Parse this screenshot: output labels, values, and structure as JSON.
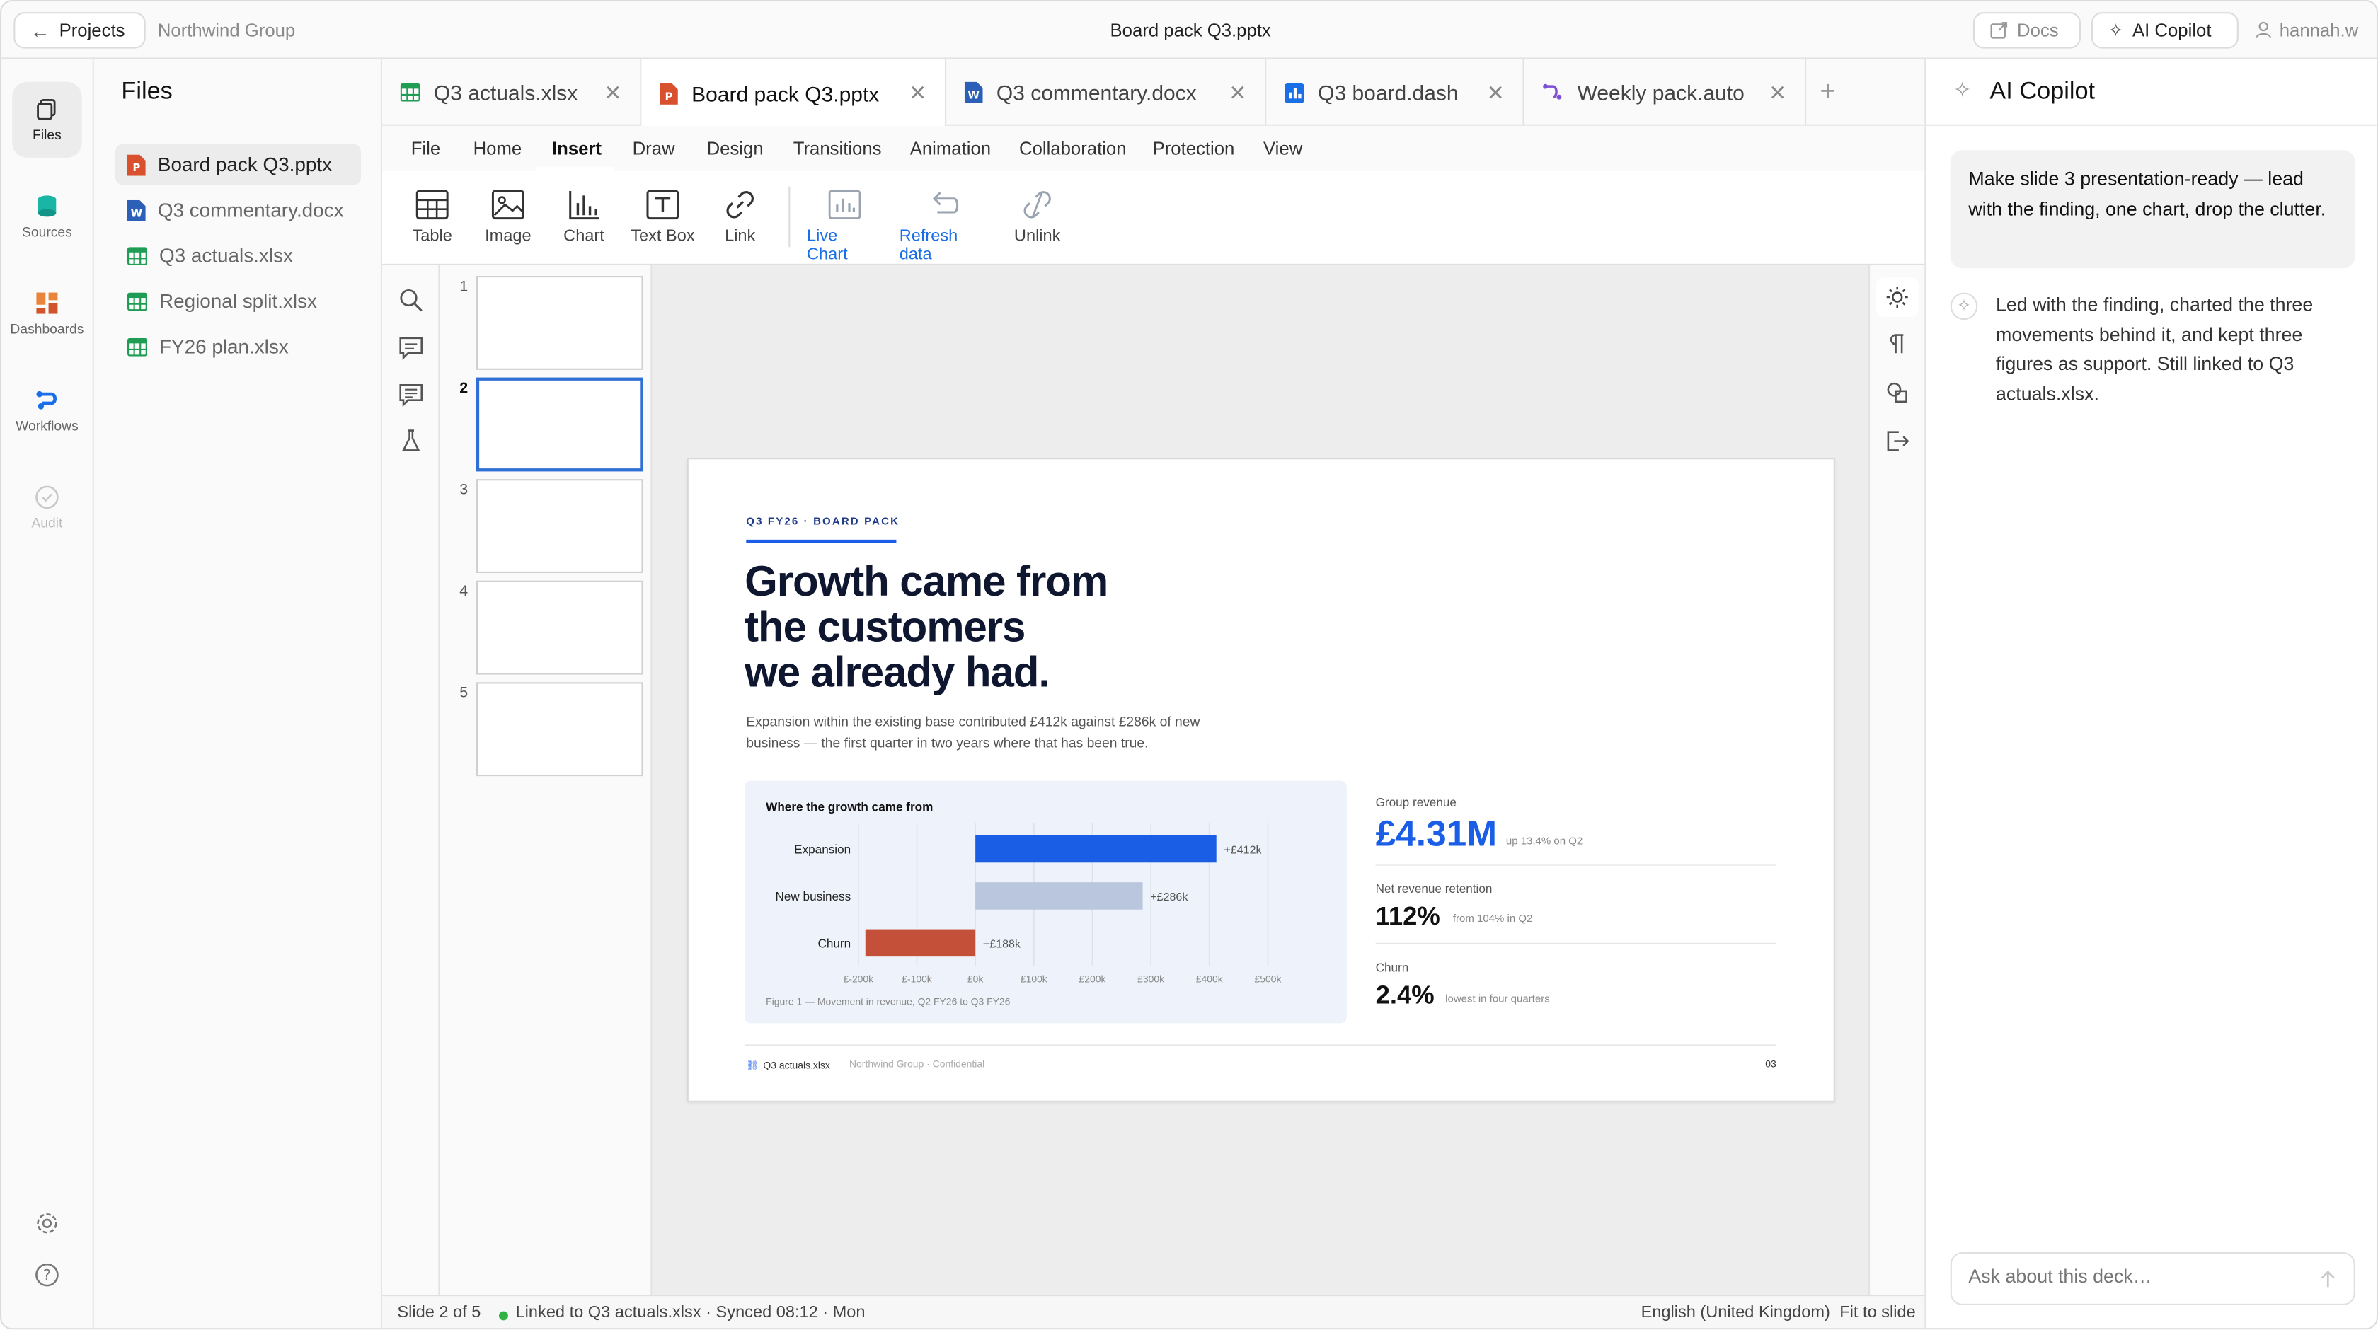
{
  "topbar": {
    "back_label": "Projects",
    "org": "Northwind Group",
    "doc_title": "Board pack Q3.pptx",
    "docs_label": "Docs",
    "copilot_label": "AI Copilot",
    "user": "hannah.w"
  },
  "rail": {
    "items": [
      {
        "label": "Files",
        "icon": "files-icon"
      },
      {
        "label": "Sources",
        "icon": "database-icon"
      },
      {
        "label": "Dashboards",
        "icon": "dashboard-icon"
      },
      {
        "label": "Workflows",
        "icon": "workflow-icon"
      },
      {
        "label": "Audit",
        "icon": "check-circle-icon"
      }
    ]
  },
  "files": {
    "title": "Files",
    "items": [
      {
        "name": "Board pack Q3.pptx",
        "type": "pptx"
      },
      {
        "name": "Q3 commentary.docx",
        "type": "docx"
      },
      {
        "name": "Q3 actuals.xlsx",
        "type": "xlsx"
      },
      {
        "name": "Regional split.xlsx",
        "type": "xlsx"
      },
      {
        "name": "FY26 plan.xlsx",
        "type": "xlsx"
      }
    ]
  },
  "tabs": [
    {
      "label": "Q3 actuals.xlsx",
      "type": "xlsx"
    },
    {
      "label": "Board pack Q3.pptx",
      "type": "pptx"
    },
    {
      "label": "Q3 commentary.docx",
      "type": "docx"
    },
    {
      "label": "Q3 board.dash",
      "type": "dash"
    },
    {
      "label": "Weekly pack.auto",
      "type": "auto"
    }
  ],
  "menu": [
    "File",
    "Home",
    "Insert",
    "Draw",
    "Design",
    "Transitions",
    "Animation",
    "Collaboration",
    "Protection",
    "View"
  ],
  "ribbon": {
    "table": "Table",
    "image": "Image",
    "chart": "Chart",
    "textbox": "Text Box",
    "link": "Link",
    "live_chart": "Live Chart",
    "refresh": "Refresh data",
    "unlink": "Unlink"
  },
  "thumbs": [
    "1",
    "2",
    "3",
    "4",
    "5"
  ],
  "slide": {
    "eyebrow": "Q3 FY26 · BOARD PACK",
    "title_lines": [
      "Growth came from",
      "the customers",
      "we already had."
    ],
    "subtitle": "Expansion within the existing base contributed £412k against £286k of new business — the first quarter in two years where that has been true.",
    "chart_title": "Where the growth came from",
    "figure_caption": "Figure 1 — Movement in revenue, Q2 FY26 to Q3 FY26",
    "kpis": [
      {
        "label": "Group revenue",
        "value": "£4.31M",
        "note": "up 13.4% on Q2"
      },
      {
        "label": "Net revenue retention",
        "value": "112%",
        "note": "from 104% in Q2"
      },
      {
        "label": "Churn",
        "value": "2.4%",
        "note": "lowest in four quarters"
      }
    ],
    "footer_source": "Q3 actuals.xlsx",
    "footer_org": "Northwind Group · Confidential",
    "page_num": "03"
  },
  "chart_data": {
    "type": "bar",
    "orientation": "horizontal",
    "title": "Where the growth came from",
    "categories": [
      "Expansion",
      "New business",
      "Churn"
    ],
    "values": [
      412,
      286,
      -188
    ],
    "data_labels": [
      "+£412k",
      "+£286k",
      "−£188k"
    ],
    "x_ticks": [
      "£-200k",
      "£-100k",
      "£0k",
      "£100k",
      "£200k",
      "£300k",
      "£400k",
      "£500k"
    ],
    "xlim": [
      -200,
      500
    ],
    "grid": true,
    "colors": {
      "Expansion": "#1a5ee6",
      "New business": "#b9c6dd",
      "Churn": "#c4503a"
    }
  },
  "status": {
    "slide": "Slide 2 of 5",
    "linked": "Linked to Q3 actuals.xlsx · Synced 08:12 · Mon",
    "language": "English (United Kingdom)",
    "fit": "Fit to slide"
  },
  "copilot": {
    "title": "AI Copilot",
    "user_message": "Make slide 3 presentation-ready — lead with the finding, one chart, drop the clutter.",
    "assistant_message": "Led with the finding, charted the three movements behind it, and kept three figures as support. Still linked to Q3 actuals.xlsx.",
    "input_placeholder": "Ask about this deck…"
  },
  "colors": {
    "accent": "#1a5ee6",
    "xlsx": "#1f9d55",
    "pptx": "#d8502d",
    "docx": "#2b5fb8",
    "status_ok": "#2fb344"
  }
}
